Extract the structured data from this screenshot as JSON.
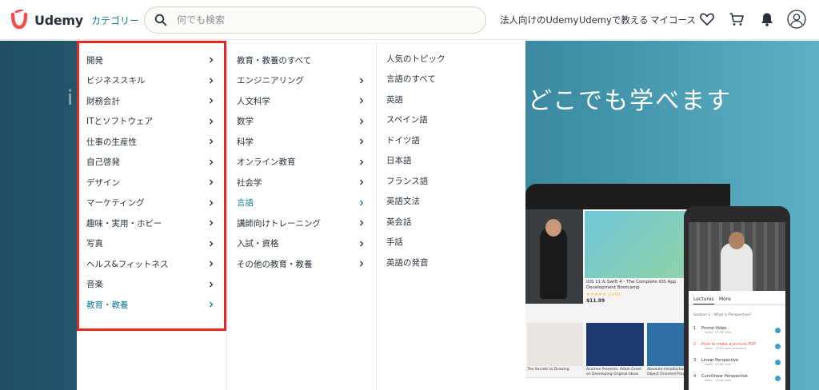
{
  "header": {
    "brand": "Udemy",
    "category_label": "カテゴリー",
    "search_placeholder": "何でも検索",
    "nav": {
      "business": "法人向けのUdemy",
      "teach": "Udemyで教える",
      "my_courses": "マイコース"
    },
    "icons": [
      "heart-icon",
      "cart-icon",
      "bell-icon",
      "user-avatar-icon"
    ]
  },
  "hero": {
    "headline": "どこでも学べます",
    "left_glimpse": "i"
  },
  "menu": {
    "categories": [
      {
        "label": "開発"
      },
      {
        "label": "ビジネススキル"
      },
      {
        "label": "財務会計"
      },
      {
        "label": "ITとソフトウェア"
      },
      {
        "label": "仕事の生産性"
      },
      {
        "label": "自己啓発"
      },
      {
        "label": "デザイン"
      },
      {
        "label": "マーケティング"
      },
      {
        "label": "趣味・実用・ホビー"
      },
      {
        "label": "写真"
      },
      {
        "label": "ヘルス&フィットネス"
      },
      {
        "label": "音楽"
      },
      {
        "label": "教育・教養"
      }
    ],
    "active_category": "教育・教養",
    "subcategories": [
      {
        "label": "教育・教養のすべて",
        "has_children": false
      },
      {
        "label": "エンジニアリング",
        "has_children": true
      },
      {
        "label": "人文科学",
        "has_children": true
      },
      {
        "label": "数学",
        "has_children": true
      },
      {
        "label": "科学",
        "has_children": true
      },
      {
        "label": "オンライン教育",
        "has_children": true
      },
      {
        "label": "社会学",
        "has_children": true
      },
      {
        "label": "言語",
        "has_children": true
      },
      {
        "label": "講師向けトレーニング",
        "has_children": true
      },
      {
        "label": "入試・資格",
        "has_children": true
      },
      {
        "label": "その他の教育・教養",
        "has_children": true
      }
    ],
    "active_subcategory": "言語",
    "topics_heading": "人気のトピック",
    "topics": [
      {
        "label": "言語のすべて"
      },
      {
        "label": "英語"
      },
      {
        "label": "スペイン語"
      },
      {
        "label": "ドイツ語"
      },
      {
        "label": "日本語"
      },
      {
        "label": "フランス語"
      },
      {
        "label": "英語文法"
      },
      {
        "label": "英会話"
      },
      {
        "label": "手話"
      },
      {
        "label": "英語の発音"
      }
    ]
  },
  "illustration": {
    "tablet_course_number": "11",
    "tablet_course_title": "iOS 11 & Swift 4 - The Complete iOS App Development Bootcamp",
    "tablet_course_rating": "★★★★★ (2482)",
    "tablet_course_price": "$11.99",
    "tablet_captions": [
      "The Secrets to Drawing",
      "Acumen Presents: Adam Grant on Developing Original Ideas",
      "Absolute Introduction to Object Oriented Programming"
    ],
    "phone_tabs": [
      "Lectures",
      "More"
    ],
    "phone_section": "Section 1 - What is Perspective?",
    "phone_lectures": [
      {
        "num": "1",
        "title": "Promo Video",
        "sub": "Video - 01:48 mins"
      },
      {
        "num": "2",
        "title": "How to make a picture POP",
        "sub": "Video - 03:23 mins remaining"
      },
      {
        "num": "3",
        "title": "Linear Perspective",
        "sub": "Video - 14:08 mins"
      },
      {
        "num": "4",
        "title": "Curvilinear Perspective",
        "sub": "Video - 09:40 mins"
      }
    ],
    "colors": {
      "brand": "#ec5252",
      "accent": "#0f7c90",
      "highlight_border": "#e8281e"
    }
  }
}
